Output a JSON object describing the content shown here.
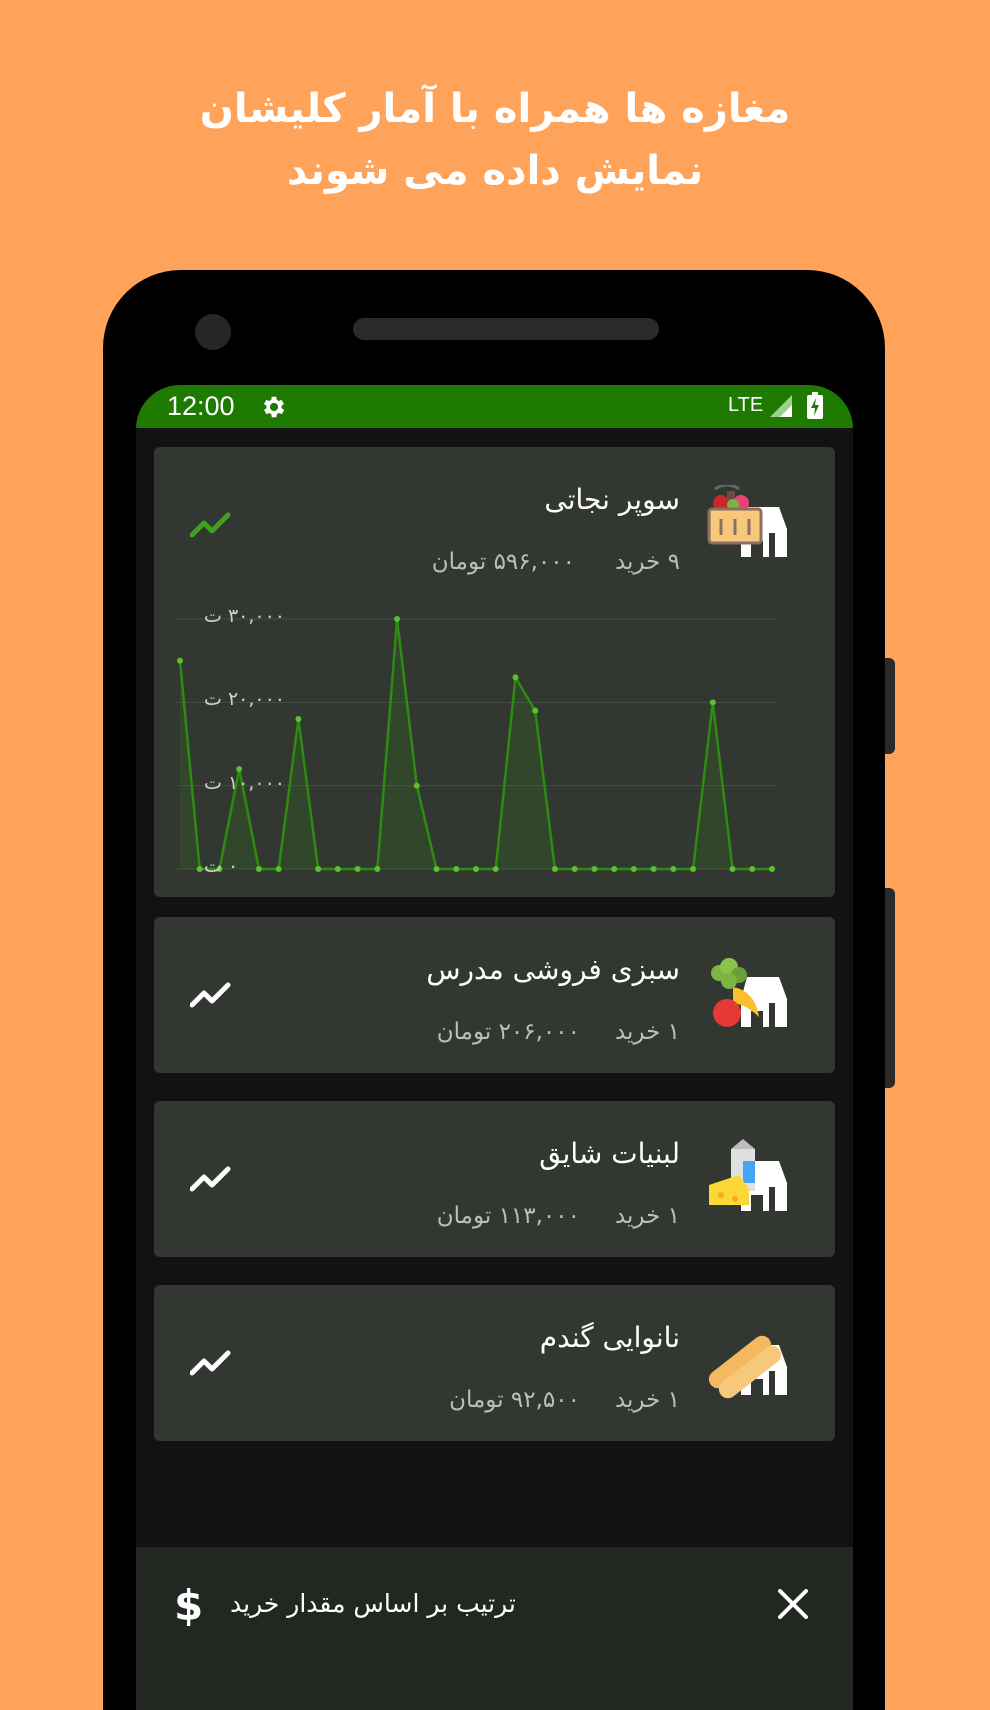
{
  "headline": {
    "line1": "مغازه ها همراه با آمار کلیشان",
    "line2": "نمایش داده می شوند"
  },
  "status_bar": {
    "time": "12:00",
    "network": "LTE",
    "bar_color": "#1E7A00"
  },
  "shops": [
    {
      "name": "سوپر نجاتی",
      "purchase_count": "۹ خرید",
      "total_amount": "۵۹۶,۰۰۰ تومان",
      "icon": "grocery-basket-store-icon",
      "trend_color": "#3DA01E",
      "expanded": true
    },
    {
      "name": "سبزی فروشی مدرس",
      "purchase_count": "۱ خرید",
      "total_amount": "۲۰۶,۰۰۰ تومان",
      "icon": "vegetables-store-icon",
      "trend_color": "#FFFFFF",
      "expanded": false
    },
    {
      "name": "لبنیات شایق",
      "purchase_count": "۱ خرید",
      "total_amount": "۱۱۳,۰۰۰ تومان",
      "icon": "dairy-store-icon",
      "trend_color": "#FFFFFF",
      "expanded": false
    },
    {
      "name": "نانوایی گندم",
      "purchase_count": "۱ خرید",
      "total_amount": "۹۲,۵۰۰ تومان",
      "icon": "bakery-store-icon",
      "trend_color": "#FFFFFF",
      "expanded": false
    }
  ],
  "chart_data": {
    "type": "area",
    "title": "",
    "xlabel": "",
    "ylabel": "",
    "ylim": [
      0,
      30000
    ],
    "y_ticks": [
      0,
      10000,
      20000,
      30000
    ],
    "y_tick_labels": [
      "۰ ت",
      "۱۰,۰۰۰ ت",
      "۲۰,۰۰۰ ت",
      "۳۰,۰۰۰ ت"
    ],
    "grid": true,
    "x": [
      0,
      1,
      2,
      3,
      4,
      5,
      6,
      7,
      8,
      9,
      10,
      11,
      12,
      13,
      14,
      15,
      16,
      17,
      18,
      19,
      20,
      21,
      22,
      23,
      24,
      25,
      26,
      27,
      28,
      29,
      30
    ],
    "series": [
      {
        "values": [
          25000,
          0,
          0,
          12000,
          0,
          0,
          18000,
          0,
          0,
          0,
          0,
          30000,
          10000,
          0,
          0,
          0,
          0,
          23000,
          19000,
          0,
          0,
          0,
          0,
          0,
          0,
          0,
          0,
          20000,
          0,
          0,
          0
        ],
        "color": "#2E8B12"
      }
    ]
  },
  "bottom_sheet": {
    "icon": "dollar-icon",
    "dollar_glyph": "$",
    "label": "ترتیب بر اساس مقدار خرید",
    "close_icon": "close-icon"
  }
}
